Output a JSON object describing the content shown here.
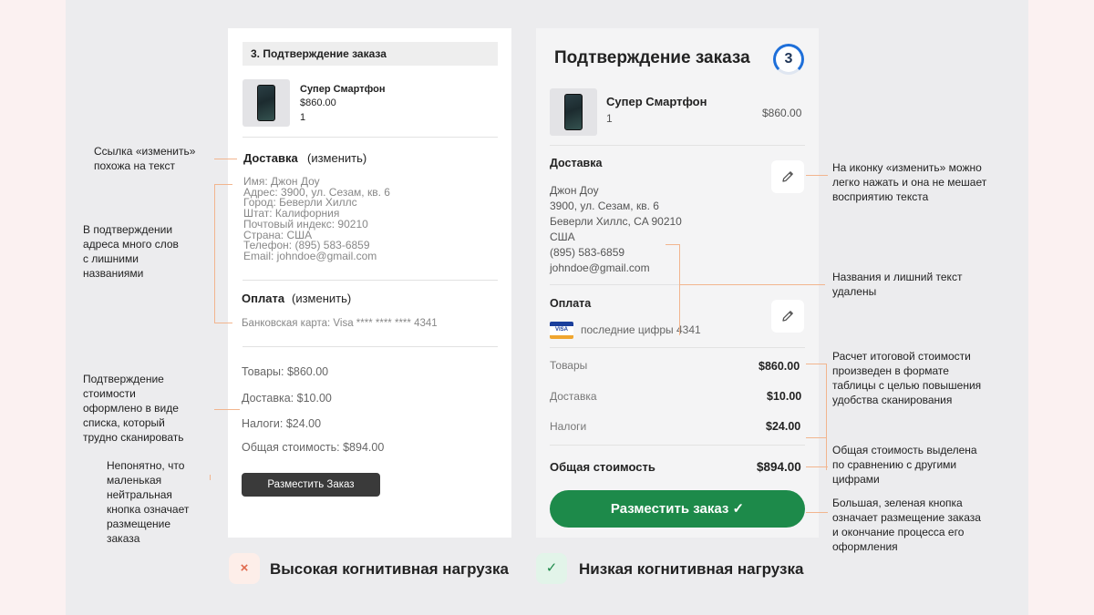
{
  "left_card": {
    "header": "3. Подтверждение заказа",
    "product": {
      "name": "Супер Смартфон",
      "price": "$860.00",
      "qty": "1"
    },
    "delivery_title": "Доставка",
    "delivery_edit": "(изменить)",
    "address_lines": [
      "Имя: Джон Доу",
      "Адрес: 3900, ул. Сезам, кв. 6",
      "Город: Беверли Хиллс",
      "Штат: Калифорния",
      "Почтовый индекс: 90210",
      "Страна: США",
      "Телефон: (895) 583-6859",
      "Email: johndoe@gmail.com"
    ],
    "payment_title": "Оплата",
    "payment_edit": "(изменить)",
    "card_line": "Банковская карта: Visa **** **** **** 4341",
    "totals": [
      "Товары: $860.00",
      "Доставка: $10.00",
      "Налоги: $24.00",
      "Общая стоимость: $894.00"
    ],
    "button": "Разместить Заказ"
  },
  "right_card": {
    "title": "Подтверждение заказа",
    "step": "3",
    "product": {
      "name": "Супер Смартфон",
      "qty": "1",
      "price": "$860.00"
    },
    "delivery_title": "Доставка",
    "address_lines": [
      "Джон Доу",
      "3900, ул. Сезам, кв. 6",
      "Беверли Хиллс, CA 90210",
      "США",
      "(895) 583-6859",
      "johndoe@gmail.com"
    ],
    "payment_title": "Оплата",
    "card_brand": "VISA",
    "card_line": "последние цифры 4341",
    "totals": [
      {
        "label": "Товары",
        "value": "$860.00"
      },
      {
        "label": "Доставка",
        "value": "$10.00"
      },
      {
        "label": "Налоги",
        "value": "$24.00"
      }
    ],
    "grand_total": {
      "label": "Общая стоимость",
      "value": "$894.00"
    },
    "button": "Разместить заказ",
    "button_icon": "✓"
  },
  "notes_left": {
    "edit_link": "Ссылка «изменить»\nпохожа на текст",
    "address": "В подтверждении\nадреса много слов\nс лишними\nназваниями",
    "list": "Подтверждение\nстоимости\nоформлено в виде\nсписка, который\nтрудно сканировать",
    "button": "Непонятно, что\nмаленькая\nнейтральная\nкнопка означает\nразмещение\nзаказа"
  },
  "notes_right": {
    "edit_icon": "На иконку «изменить» можно\nлегко нажать и она не мешает\nвосприятию текста",
    "removed": "Названия и лишний текст\nудалены",
    "table": "Расчет итоговой стоимости\nпроизведен в формате\nтаблицы с целью повышения\nудобства сканирования",
    "total": "Общая стоимость выделена\nпо сравнению с другими\nцифрами",
    "button": "Большая, зеленая кнопка\nозначает размещение заказа\nи окончание процесса его\nоформления"
  },
  "captions": {
    "bad": "Высокая когнитивная нагрузка",
    "bad_icon": "×",
    "good": "Низкая когнитивная нагрузка",
    "good_icon": "✓"
  },
  "colors": {
    "accent_green": "#1d8a4a",
    "annotation_line": "#f2b58e",
    "step_blue": "#1e6fd9"
  }
}
